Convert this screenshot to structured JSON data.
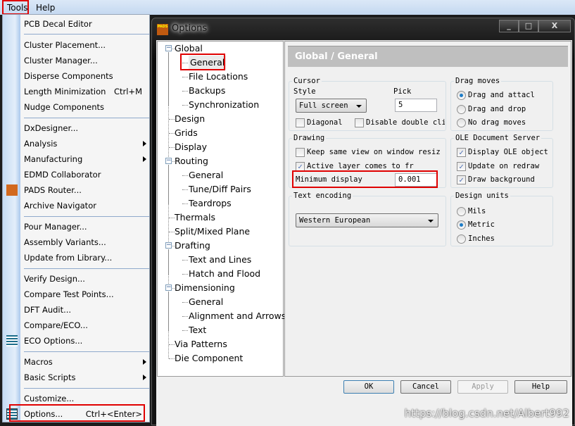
{
  "menubar": {
    "items": [
      "Tools",
      "Help"
    ]
  },
  "menu": {
    "items": [
      {
        "label": "PCB Decal Editor"
      },
      {
        "label": "Cluster Placement..."
      },
      {
        "label": "Cluster Manager..."
      },
      {
        "label": "Disperse Components"
      },
      {
        "label": "Length Minimization",
        "shortcut": "Ctrl+M"
      },
      {
        "label": "Nudge Components"
      },
      {
        "label": "DxDesigner..."
      },
      {
        "label": "Analysis",
        "submenu": true
      },
      {
        "label": "Manufacturing",
        "submenu": true
      },
      {
        "label": "EDMD Collaborator"
      },
      {
        "label": "PADS Router...",
        "icon": "pads-router-icon"
      },
      {
        "label": "Archive Navigator"
      },
      {
        "label": "Pour Manager..."
      },
      {
        "label": "Assembly Variants..."
      },
      {
        "label": "Update from Library..."
      },
      {
        "label": "Verify Design..."
      },
      {
        "label": "Compare Test Points..."
      },
      {
        "label": "DFT Audit..."
      },
      {
        "label": "Compare/ECO..."
      },
      {
        "label": "ECO Options...",
        "icon": "eco-options-icon"
      },
      {
        "label": "Macros",
        "submenu": true
      },
      {
        "label": "Basic Scripts",
        "submenu": true
      },
      {
        "label": "Customize..."
      },
      {
        "label": "Options...",
        "shortcut": "Ctrl+<Enter>",
        "icon": "options-icon"
      }
    ]
  },
  "dialog": {
    "title": "Options",
    "icon_text": "PADS",
    "window_buttons": [
      "_",
      "□",
      "X"
    ],
    "tree": [
      {
        "label": "Global",
        "level": 0,
        "expand": "−"
      },
      {
        "label": "General",
        "level": 1,
        "selected": true
      },
      {
        "label": "File Locations",
        "level": 1
      },
      {
        "label": "Backups",
        "level": 1
      },
      {
        "label": "Synchronization",
        "level": 1
      },
      {
        "label": "Design",
        "level": 0
      },
      {
        "label": "Grids",
        "level": 0
      },
      {
        "label": "Display",
        "level": 0
      },
      {
        "label": "Routing",
        "level": 0,
        "expand": "−"
      },
      {
        "label": "General",
        "level": 1
      },
      {
        "label": "Tune/Diff Pairs",
        "level": 1
      },
      {
        "label": "Teardrops",
        "level": 1
      },
      {
        "label": "Thermals",
        "level": 0
      },
      {
        "label": "Split/Mixed Plane",
        "level": 0
      },
      {
        "label": "Drafting",
        "level": 0,
        "expand": "−"
      },
      {
        "label": "Text and Lines",
        "level": 1
      },
      {
        "label": "Hatch and Flood",
        "level": 1
      },
      {
        "label": "Dimensioning",
        "level": 0,
        "expand": "−"
      },
      {
        "label": "General",
        "level": 1
      },
      {
        "label": "Alignment and Arrows",
        "level": 1
      },
      {
        "label": "Text",
        "level": 1
      },
      {
        "label": "Via Patterns",
        "level": 0
      },
      {
        "label": "Die Component",
        "level": 0
      }
    ],
    "header": "Global / General",
    "cursor": {
      "title": "Cursor",
      "style_label": "Style",
      "style_value": "Full screen",
      "pick_label": "Pick",
      "pick_value": "5",
      "diagonal": "Diagonal",
      "disable_dbl": "Disable double cli"
    },
    "drawing": {
      "title": "Drawing",
      "keep_view": "Keep same view on window resiz",
      "active_layer": "Active layer comes to fr",
      "min_display_label": "Minimum display",
      "min_display_value": "0.001"
    },
    "text_encoding": {
      "title": "Text encoding",
      "value": "Western European"
    },
    "drag_moves": {
      "title": "Drag moves",
      "options": [
        "Drag and attacl",
        "Drag and drop",
        "No drag moves"
      ],
      "selected": 0
    },
    "ole": {
      "title": "OLE Document Server",
      "display": "Display OLE object",
      "update": "Update on redraw",
      "background": "Draw background"
    },
    "design_units": {
      "title": "Design units",
      "options": [
        "Mils",
        "Metric",
        "Inches"
      ],
      "selected": 1
    },
    "buttons": {
      "ok": "OK",
      "cancel": "Cancel",
      "apply": "Apply",
      "help": "Help"
    }
  },
  "watermark": "https://blog.csdn.net/Albert992",
  "colors": {
    "highlight": "#e00000",
    "accent": "#1d7cc7"
  }
}
